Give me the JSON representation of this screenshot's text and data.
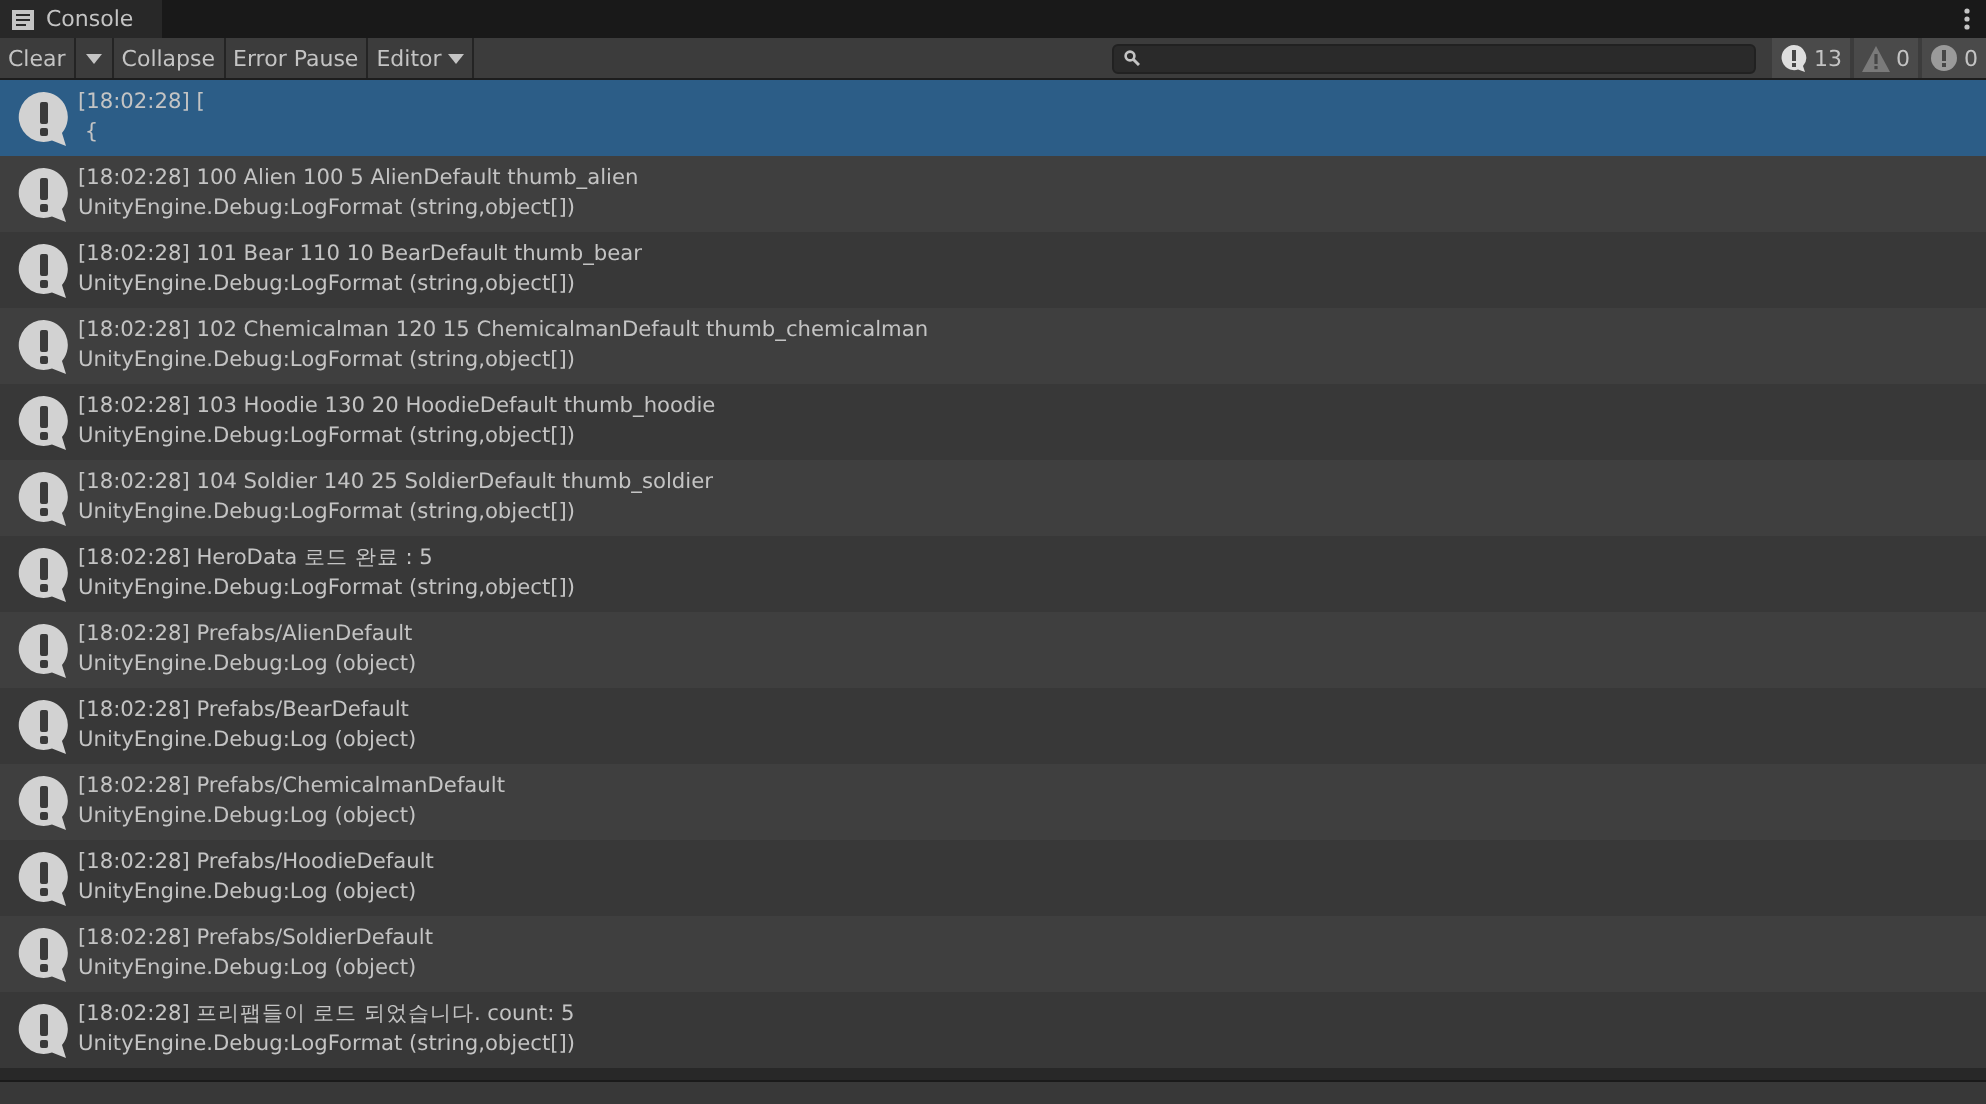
{
  "tab": {
    "title": "Console"
  },
  "toolbar": {
    "buttons": [
      {
        "label": "Clear",
        "kind": "split"
      },
      {
        "label": "Collapse",
        "kind": "plain"
      },
      {
        "label": "Error Pause",
        "kind": "plain"
      },
      {
        "label": "Editor",
        "kind": "dropdown"
      }
    ],
    "counters": [
      {
        "kind": "info",
        "count": "13"
      },
      {
        "kind": "warning",
        "count": "0"
      },
      {
        "kind": "error",
        "count": "0"
      }
    ]
  },
  "logs": [
    {
      "line1": "[18:02:28] [",
      "line2": " {",
      "selected": true
    },
    {
      "line1": "[18:02:28] 100 Alien 100 5 AlienDefault thumb_alien",
      "line2": "UnityEngine.Debug:LogFormat (string,object[])",
      "selected": false
    },
    {
      "line1": "[18:02:28] 101 Bear 110 10 BearDefault thumb_bear",
      "line2": "UnityEngine.Debug:LogFormat (string,object[])",
      "selected": false
    },
    {
      "line1": "[18:02:28] 102 Chemicalman 120 15 ChemicalmanDefault thumb_chemicalman",
      "line2": "UnityEngine.Debug:LogFormat (string,object[])",
      "selected": false
    },
    {
      "line1": "[18:02:28] 103 Hoodie 130 20 HoodieDefault thumb_hoodie",
      "line2": "UnityEngine.Debug:LogFormat (string,object[])",
      "selected": false
    },
    {
      "line1": "[18:02:28] 104 Soldier 140 25 SoldierDefault thumb_soldier",
      "line2": "UnityEngine.Debug:LogFormat (string,object[])",
      "selected": false
    },
    {
      "line1": "[18:02:28] HeroData 로드 완료 : 5",
      "line2": "UnityEngine.Debug:LogFormat (string,object[])",
      "selected": false
    },
    {
      "line1": "[18:02:28] Prefabs/AlienDefault",
      "line2": "UnityEngine.Debug:Log (object)",
      "selected": false
    },
    {
      "line1": "[18:02:28] Prefabs/BearDefault",
      "line2": "UnityEngine.Debug:Log (object)",
      "selected": false
    },
    {
      "line1": "[18:02:28] Prefabs/ChemicalmanDefault",
      "line2": "UnityEngine.Debug:Log (object)",
      "selected": false
    },
    {
      "line1": "[18:02:28] Prefabs/HoodieDefault",
      "line2": "UnityEngine.Debug:Log (object)",
      "selected": false
    },
    {
      "line1": "[18:02:28] Prefabs/SoldierDefault",
      "line2": "UnityEngine.Debug:Log (object)",
      "selected": false
    },
    {
      "line1": "[18:02:28] 프리팹들이 로드 되었습니다. count: 5",
      "line2": "UnityEngine.Debug:LogFormat (string,object[])",
      "selected": false
    }
  ]
}
